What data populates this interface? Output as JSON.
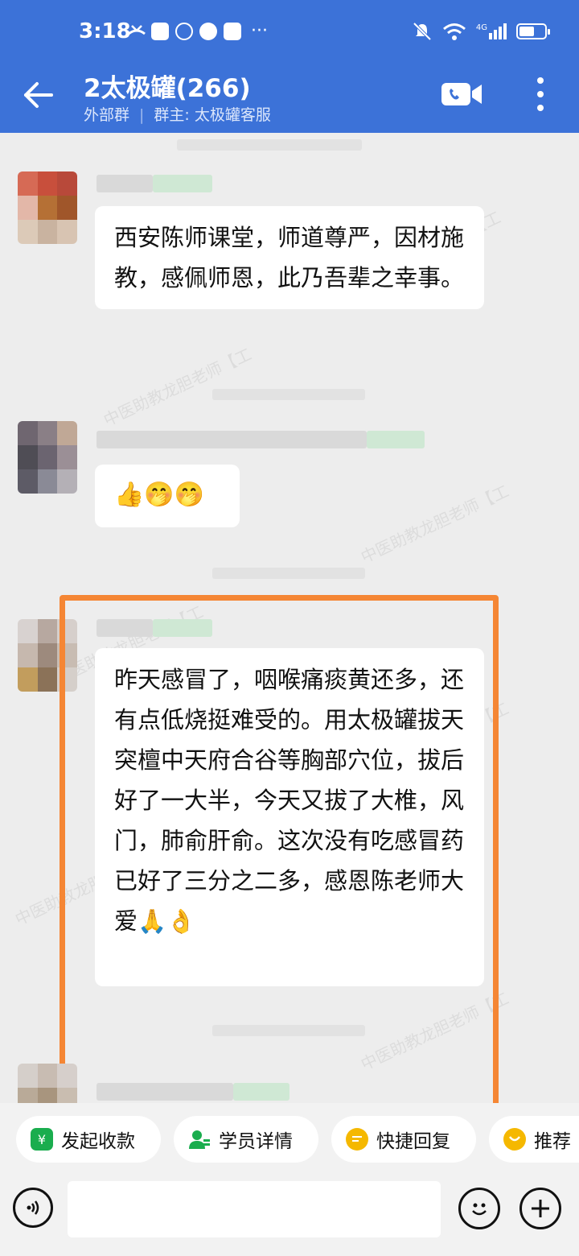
{
  "status_bar": {
    "time": "3:18",
    "more": "···",
    "network": "4G"
  },
  "header": {
    "title": "2太极罐(266)",
    "group_type": "外部群",
    "owner": "群主: 太极罐客服"
  },
  "messages": [
    {
      "text": "西安陈师课堂，师道尊严，因材施教，感佩师恩，此乃吾辈之幸事。"
    },
    {
      "text": "👍🤭🤭"
    },
    {
      "text": "昨天感冒了，咽喉痛痰黄还多，还有点低烧挺难受的。用太极罐拔天突檀中天府合谷等胸部穴位，拔后好了一大半，今天又拔了大椎，风门，肺俞肝俞。这次没有吃感冒药已好了三分之二多，感恩陈老师大爱🙏👌"
    }
  ],
  "watermark": "中医助教龙胆老师【工",
  "quick_actions": [
    {
      "label": "发起收款",
      "icon": "shield-yuan-icon",
      "color": "#1aad4e"
    },
    {
      "label": "学员详情",
      "icon": "user-detail-icon",
      "color": "#1aad4e"
    },
    {
      "label": "快捷回复",
      "icon": "quick-reply-icon",
      "color": "#f5b800"
    },
    {
      "label": "推荐",
      "icon": "recommend-icon",
      "color": "#f5b800"
    }
  ],
  "input": {
    "placeholder": ""
  },
  "colors": {
    "header": "#3c72d8",
    "highlight": "#f58634"
  }
}
